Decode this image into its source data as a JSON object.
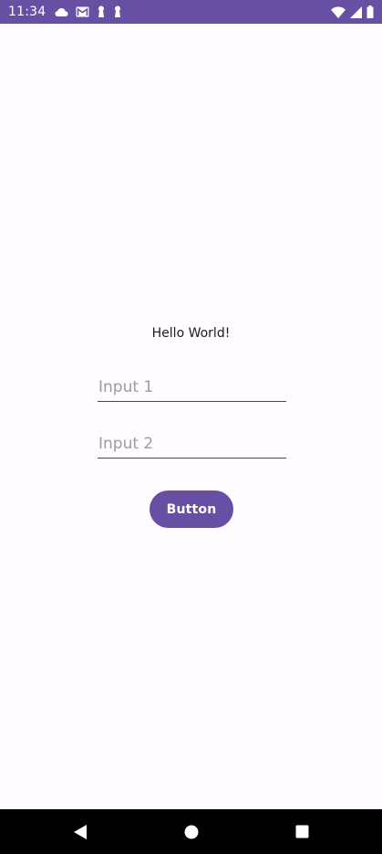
{
  "status_bar": {
    "time": "11:34",
    "background": "#6750a4",
    "left_icons": [
      "cloud-icon",
      "gmail-icon",
      "keyhole-icon",
      "keyhole-icon"
    ],
    "right_icons": [
      "wifi-icon",
      "signal-icon",
      "battery-icon"
    ]
  },
  "content": {
    "hello_text": "Hello World!",
    "input1": {
      "value": "",
      "placeholder": "Input 1"
    },
    "input2": {
      "value": "",
      "placeholder": "Input 2"
    },
    "button_label": "Button",
    "accent": "#6750a4",
    "background": "#fffbfe"
  },
  "nav_bar": {
    "buttons": [
      "back-icon",
      "home-icon",
      "recents-icon"
    ]
  }
}
